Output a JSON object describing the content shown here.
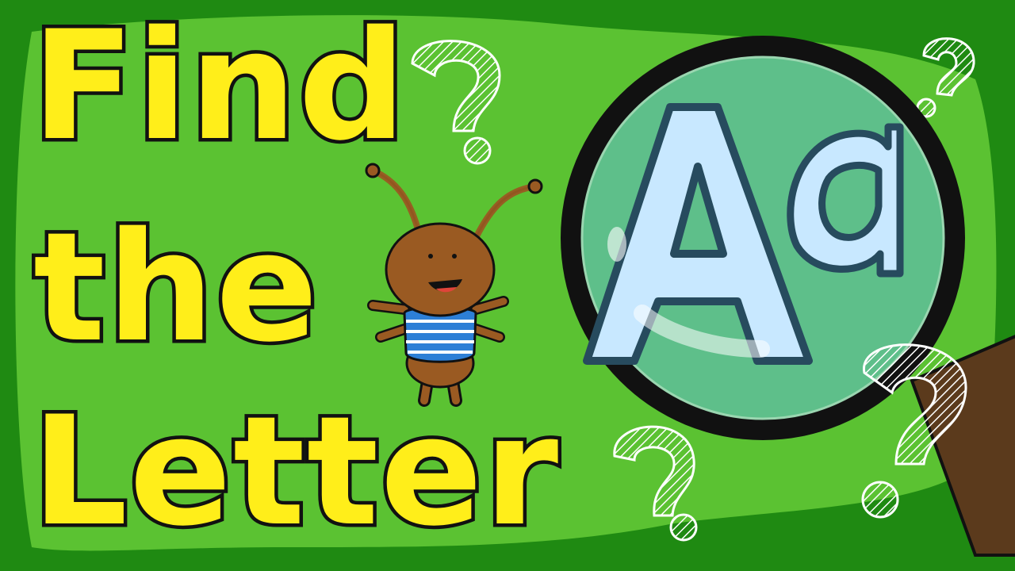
{
  "title": {
    "line1": "Find",
    "line2": "the",
    "line3": "Letter"
  },
  "magnifier": {
    "letters": [
      "A",
      "a"
    ]
  },
  "colors": {
    "background_dark": "#1f8a12",
    "background_light": "#5bc232",
    "title_fill": "#ffee1a",
    "outline": "#111111",
    "lens": "#5ebf8a",
    "letter_fill": "#c8e8ff",
    "letter_outline": "#274b5e",
    "handle": "#5b3a1c",
    "bug_body": "#9a5a22",
    "bug_shirt": "#2d7fd6"
  },
  "icons": [
    "question-mark-icon",
    "magnifying-glass-icon",
    "ant-character"
  ]
}
